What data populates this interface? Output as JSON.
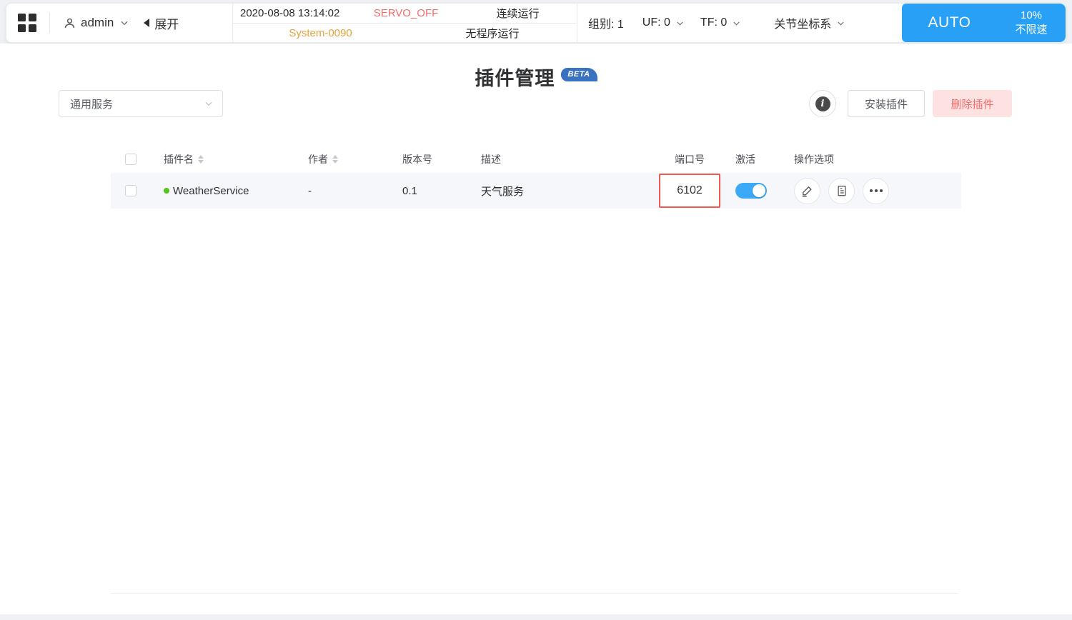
{
  "topbar": {
    "user": {
      "name": "admin"
    },
    "collapse": {
      "label": "展开"
    },
    "status": {
      "datetime": "2020-08-08 13:14:02",
      "servo": "SERVO_OFF",
      "run_mode": "连续运行",
      "system": "System-0090",
      "program": "无程序运行"
    },
    "robot": {
      "group": "组别: 1",
      "uf": "UF: 0",
      "tf": "TF: 0",
      "coord": "关节坐标系"
    },
    "mode_panel": {
      "mode": "AUTO",
      "speed": "10%",
      "limit": "不限速"
    }
  },
  "page": {
    "title": "插件管理",
    "badge": "BETA",
    "filter_value": "通用服务",
    "install_label": "安装插件",
    "delete_label": "删除插件",
    "info_glyph": "i"
  },
  "table": {
    "headers": [
      {
        "label": "插件名",
        "sortable": true
      },
      {
        "label": "作者",
        "sortable": true
      },
      {
        "label": "版本号",
        "sortable": false
      },
      {
        "label": "描述",
        "sortable": false
      },
      {
        "label": "端口号",
        "sortable": false
      },
      {
        "label": "激活",
        "sortable": false
      },
      {
        "label": "操作选项",
        "sortable": false
      }
    ],
    "rows": [
      {
        "name": "WeatherService",
        "status_dot": "green",
        "author": "-",
        "version": "0.1",
        "description": "天气服务",
        "port": "6102",
        "port_highlighted": true,
        "active": true,
        "actions": [
          "edit-icon",
          "document-icon",
          "more-icon"
        ]
      }
    ]
  },
  "colors": {
    "accent_blue": "#27a0f5",
    "toggle_blue": "#3aa9f7",
    "badge_blue": "#3a72c2",
    "servo_red": "#f56c6c",
    "system_orange": "#e6a23c",
    "delete_bg": "#fde2e2",
    "delete_text": "#f56c6c",
    "highlight_red": "#f05a52",
    "status_dot_green": "#52c41a"
  }
}
